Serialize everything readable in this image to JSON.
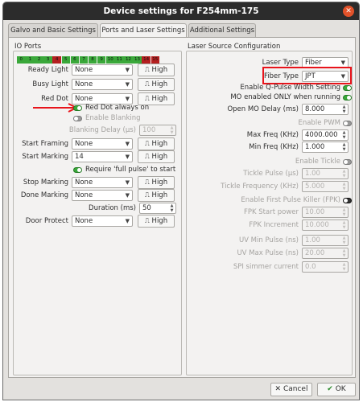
{
  "window": {
    "title": "Device settings for F254mm-175"
  },
  "tabs": [
    {
      "label": "Galvo and Basic Settings"
    },
    {
      "label": "Ports and Laser Settings"
    },
    {
      "label": "Additional Settings"
    }
  ],
  "colors": {
    "io_on": "#3aa83a",
    "io_off": "#b52020",
    "annotation_red": "#e8141b"
  },
  "io": {
    "title": "IO Ports",
    "blocks": [
      {
        "label": "0",
        "state": "on"
      },
      {
        "label": "1",
        "state": "on"
      },
      {
        "label": "2",
        "state": "on"
      },
      {
        "label": "3",
        "state": "on"
      },
      {
        "label": "4",
        "state": "off"
      },
      {
        "label": "5",
        "state": "on"
      },
      {
        "label": "6",
        "state": "on"
      },
      {
        "label": "7",
        "state": "on"
      },
      {
        "label": "8",
        "state": "on"
      },
      {
        "label": "9",
        "state": "on"
      },
      {
        "label": "10",
        "state": "on"
      },
      {
        "label": "11",
        "state": "on"
      },
      {
        "label": "12",
        "state": "on"
      },
      {
        "label": "13",
        "state": "on"
      },
      {
        "label": "14",
        "state": "off"
      },
      {
        "label": "15",
        "state": "off"
      }
    ],
    "rows": {
      "ready_light": {
        "label": "Ready Light",
        "value": "None",
        "btn": "High"
      },
      "busy_light": {
        "label": "Busy Light",
        "value": "None",
        "btn": "High"
      },
      "red_dot": {
        "label": "Red Dot",
        "value": "None",
        "btn": "High"
      },
      "start_framing": {
        "label": "Start Framing",
        "value": "None",
        "btn": "High"
      },
      "start_marking": {
        "label": "Start Marking",
        "value": "14",
        "btn": "High"
      },
      "stop_marking": {
        "label": "Stop Marking",
        "value": "None",
        "btn": "High"
      },
      "done_marking": {
        "label": "Done Marking",
        "value": "None",
        "btn": "High"
      },
      "door_protect": {
        "label": "Door Protect",
        "value": "None",
        "btn": "High"
      }
    },
    "red_dot_always_on": "Red Dot always on",
    "enable_blanking": "Enable Blanking",
    "blanking_delay": {
      "label": "Blanking Delay (μs)",
      "value": "100"
    },
    "require_full_pulse": "Require 'full pulse' to start",
    "duration": {
      "label": "Duration (ms)",
      "value": "50"
    }
  },
  "laser": {
    "title": "Laser Source Configuration",
    "laser_type": {
      "label": "Laser Type",
      "value": "Fiber"
    },
    "fiber_type": {
      "label": "Fiber Type",
      "value": "JPT"
    },
    "enable_qpulse": "Enable Q-Pulse Width Setting",
    "mo_enabled": "MO enabled ONLY when running",
    "open_mo_delay": {
      "label": "Open MO Delay (ms)",
      "value": "8.000"
    },
    "enable_pwm": "Enable PWM",
    "max_freq": {
      "label": "Max Freq (KHz)",
      "value": "4000.000"
    },
    "min_freq": {
      "label": "Min Freq (KHz)",
      "value": "1.000"
    },
    "enable_tickle": "Enable Tickle",
    "tickle_pulse": {
      "label": "Tickle Pulse (μs)",
      "value": "1.00"
    },
    "tickle_freq": {
      "label": "Tickle Frequency (KHz)",
      "value": "5.000"
    },
    "enable_fpk": "Enable First Pulse Killer (FPK)",
    "fpk_start": {
      "label": "FPK Start power",
      "value": "10.00"
    },
    "fpk_increment": {
      "label": "FPK Increment",
      "value": "10.000"
    },
    "uv_min": {
      "label": "UV Min Pulse (ns)",
      "value": "1.00"
    },
    "uv_max": {
      "label": "UV Max Pulse (ns)",
      "value": "20.00"
    },
    "spi_simmer": {
      "label": "SPI simmer current",
      "value": "0.0"
    }
  },
  "footer": {
    "cancel": "Cancel",
    "ok": "OK"
  }
}
